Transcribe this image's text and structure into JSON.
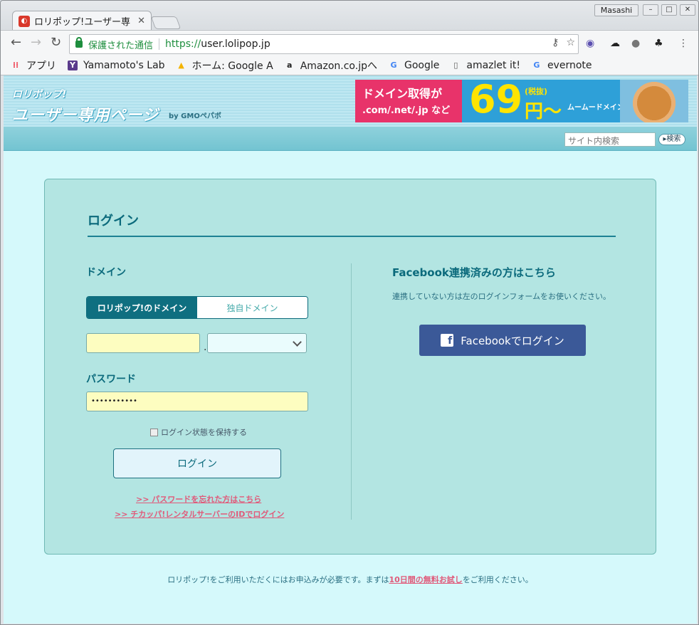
{
  "browser": {
    "tab_title": "ロリポップ!ユーザー専",
    "user_name": "Masashi",
    "secure_label": "保護された通信",
    "url_scheme": "https://",
    "url_host": "user.lolipop.jp"
  },
  "bookmarks": [
    {
      "label": "アプリ",
      "icon": "apps-grid-icon"
    },
    {
      "label": "Yamamoto's Lab",
      "icon": "yamamoto-icon"
    },
    {
      "label": "ホーム: Google A",
      "icon": "google-drive-icon"
    },
    {
      "label": "Amazon.co.jpへ",
      "icon": "amazon-icon"
    },
    {
      "label": "Google",
      "icon": "google-icon"
    },
    {
      "label": "amazlet it!",
      "icon": "page-icon"
    },
    {
      "label": "evernote",
      "icon": "google-icon"
    }
  ],
  "header": {
    "logo_top": "ロリポップ!",
    "logo_main": "ユーザー専用ページ",
    "logo_by": "by GMOペパボ",
    "banner": {
      "line1": "ドメイン取得が",
      "line2": ".com/.net/.jp など",
      "price": "69",
      "tax": "(税抜)",
      "yen": "円〜",
      "brand": "ムームードメイン"
    },
    "search_placeholder": "サイト内検索",
    "search_button": "検索"
  },
  "login": {
    "title": "ログイン",
    "domain_label": "ドメイン",
    "tab_lolipop": "ロリポップ!のドメイン",
    "tab_own": "独自ドメイン",
    "account_value": "",
    "domain_select": "",
    "dot": ".",
    "password_label": "パスワード",
    "password_value": "•••••••••••",
    "remember_label": "ログイン状態を保持する",
    "login_button": "ログイン",
    "forgot_link": ">> パスワードを忘れた方はこちら",
    "chicappa_link": ">> チカッパ!レンタルサーバーのIDでログイン"
  },
  "facebook": {
    "title": "Facebook連携済みの方はこちら",
    "note": "連携していない方は左のログインフォームをお使いください。",
    "button": "Facebookでログイン"
  },
  "footer": {
    "before": "ロリポップ!をご利用いただくにはお申込みが必要です。まずは",
    "link": "10日間の無料お試し",
    "after": "をご利用ください。"
  }
}
